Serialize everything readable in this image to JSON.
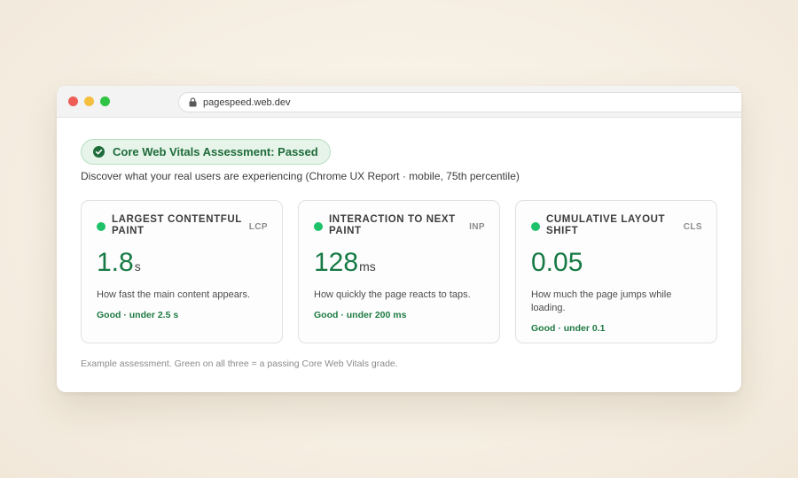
{
  "browser": {
    "url": "pagespeed.web.dev",
    "icons": {
      "lock": "lock-icon"
    }
  },
  "assessment": {
    "status_label": "Core Web Vitals Assessment: Passed",
    "status_icon": "check-circle-icon",
    "status_color": "#1f6b3a",
    "description": "Discover what your real users are experiencing (Chrome UX Report · mobile, 75th percentile)"
  },
  "metrics": [
    {
      "name": "LARGEST CONTENTFUL PAINT",
      "abbr": "LCP",
      "value": "1.8",
      "unit": "s",
      "description": "How fast the main content appears.",
      "grade": "Good · under 2.5 s"
    },
    {
      "name": "INTERACTION TO NEXT PAINT",
      "abbr": "INP",
      "value": "128",
      "unit": "ms",
      "description": "How quickly the page reacts to taps.",
      "grade": "Good · under 200 ms"
    },
    {
      "name": "CUMULATIVE LAYOUT SHIFT",
      "abbr": "CLS",
      "value": "0.05",
      "unit": "",
      "description": "How much the page jumps while loading.",
      "grade": "Good · under 0.1"
    }
  ],
  "colors": {
    "good": "#1fc16a",
    "value_text": "#167a44"
  },
  "footnote": "Example assessment. Green on all three = a passing Core Web Vitals grade."
}
